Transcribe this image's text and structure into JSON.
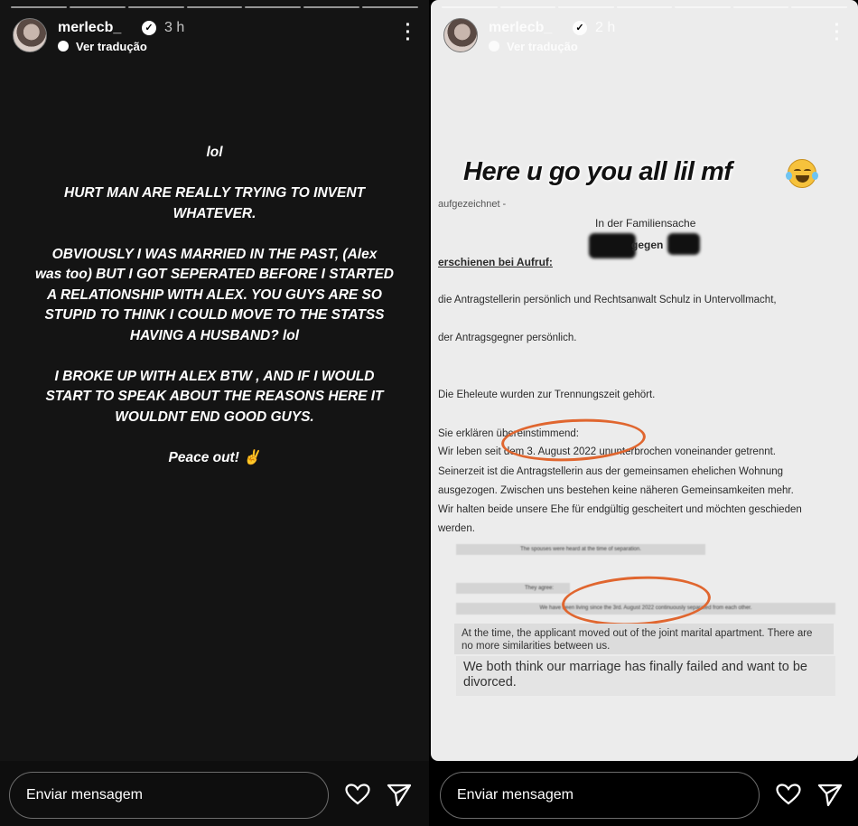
{
  "left_story": {
    "username": "merlecb_",
    "time": "3 h",
    "translate": "Ver tradução",
    "more": "⋮",
    "paragraphs": [
      "lol",
      "HURT MAN ARE REALLY TRYING TO INVENT\nWHATEVER.",
      "OBVIOUSLY I WAS MARRIED IN THE PAST, (Alex\nwas too) BUT I  GOT SEPERATED BEFORE I STARTED\nA RELATIONSHIP WITH ALEX.  YOU GUYS ARE SO\nSTUPID TO THINK I COULD MOVE TO THE STATSS\nHAVING A HUSBAND? lol",
      "I BROKE UP WITH ALEX BTW , AND IF I WOULD\nSTART TO SPEAK ABOUT THE REASONS HERE IT\nWOULDNT END GOOD GUYS.",
      "Peace out! ✌"
    ],
    "message_placeholder": "Enviar mensagem"
  },
  "right_story": {
    "username": "merlecb_",
    "time": "2 h",
    "translate": "Ver tradução",
    "more": "⋮",
    "headline": "Here u go you all lil mf",
    "document": {
      "top_cut": "aufgezeichnet -",
      "case": "In der Familiensache",
      "parties": "gegen",
      "appeared": "erschienen bei Aufruf:",
      "line1": "die Antragstellerin persönlich und Rechtsanwalt Schulz in Untervollmacht,",
      "line2": "der Antragsgegner persönlich.",
      "line3": "Die Eheleute wurden zur Trennungszeit gehört.",
      "p1": "Sie erklären übereinstimmend:",
      "p2": "Wir leben seit dem 3. August 2022 ununterbrochen voneinander getrennt.",
      "p3": "Seinerzeit ist die Antragstellerin aus der gemeinsamen ehelichen Wohnung",
      "p4": "ausgezogen. Zwischen uns bestehen keine näheren Gemeinsamkeiten mehr.",
      "p5": "Wir halten beide unsere Ehe für endgültig gescheitert und möchten geschieden",
      "p6": "werden."
    },
    "translation": {
      "s1": "The spouses were heard at the time of separation.",
      "s2": "They agree:",
      "s3": "We have been living since the 3rd. August 2022 continuously separated from each other.",
      "s4": "At the time, the applicant moved out of the joint marital apartment. There are no more similarities between us.",
      "s5": "We both think our marriage has finally failed and want to be divorced."
    },
    "message_placeholder": "Enviar mensagem"
  }
}
